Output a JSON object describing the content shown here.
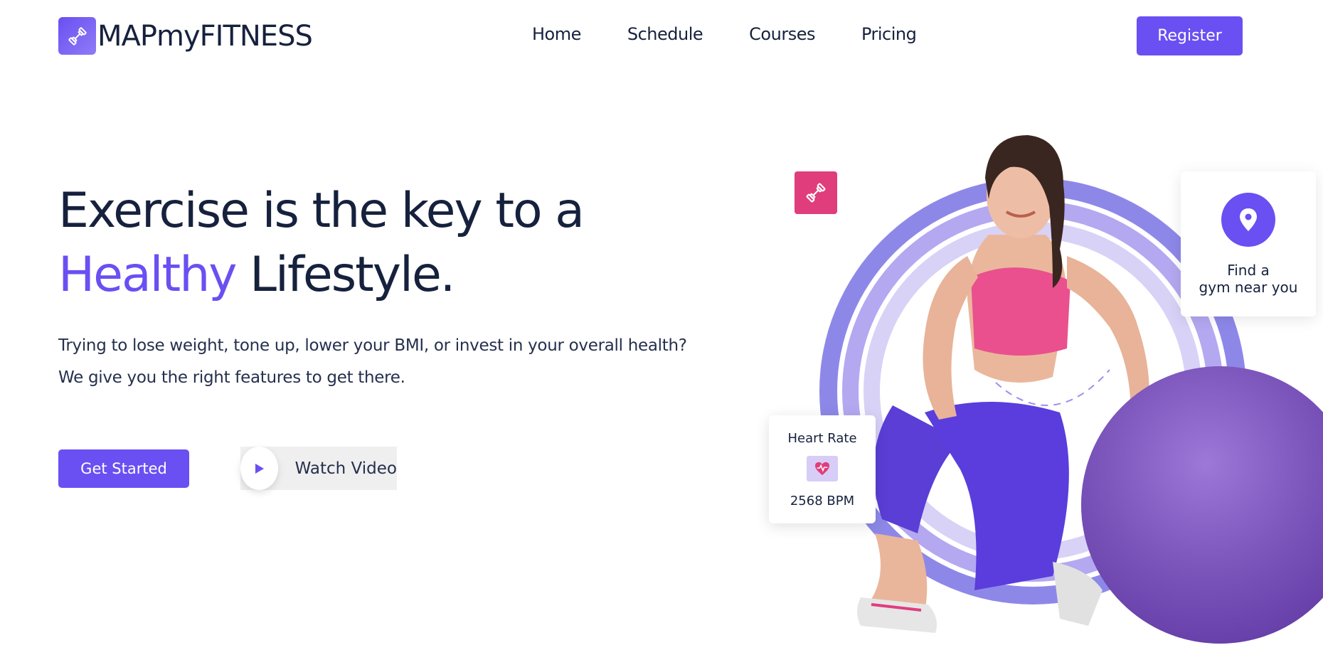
{
  "brand": {
    "name": "MAPmyFITNESS",
    "accent_color": "#6a4ff2",
    "logo_icon": "dumbbell-icon"
  },
  "nav": {
    "items": [
      {
        "label": "Home"
      },
      {
        "label": "Schedule"
      },
      {
        "label": "Courses"
      },
      {
        "label": "Pricing"
      }
    ],
    "register_label": "Register"
  },
  "hero": {
    "headline_line1": "Exercise is the key to a",
    "headline_accent": "Healthy",
    "headline_rest": " Lifestyle.",
    "subtext_line1": "Trying to lose weight, tone up, lower your BMI, or invest in your overall health?",
    "subtext_line2": "We give you the right features to get there.",
    "cta_label": "Get Started",
    "video_label": "Watch Video"
  },
  "widgets": {
    "gym_finder_text": "Find a\ngym near you",
    "gym_finder_icon": "location-pin-icon",
    "heart_rate_title": "Heart Rate",
    "heart_rate_value": "2568 BPM",
    "heart_rate_icon": "heart-pulse-icon",
    "floating_badge_icon": "dumbbell-icon",
    "floating_badge_color": "#e03d7c"
  }
}
